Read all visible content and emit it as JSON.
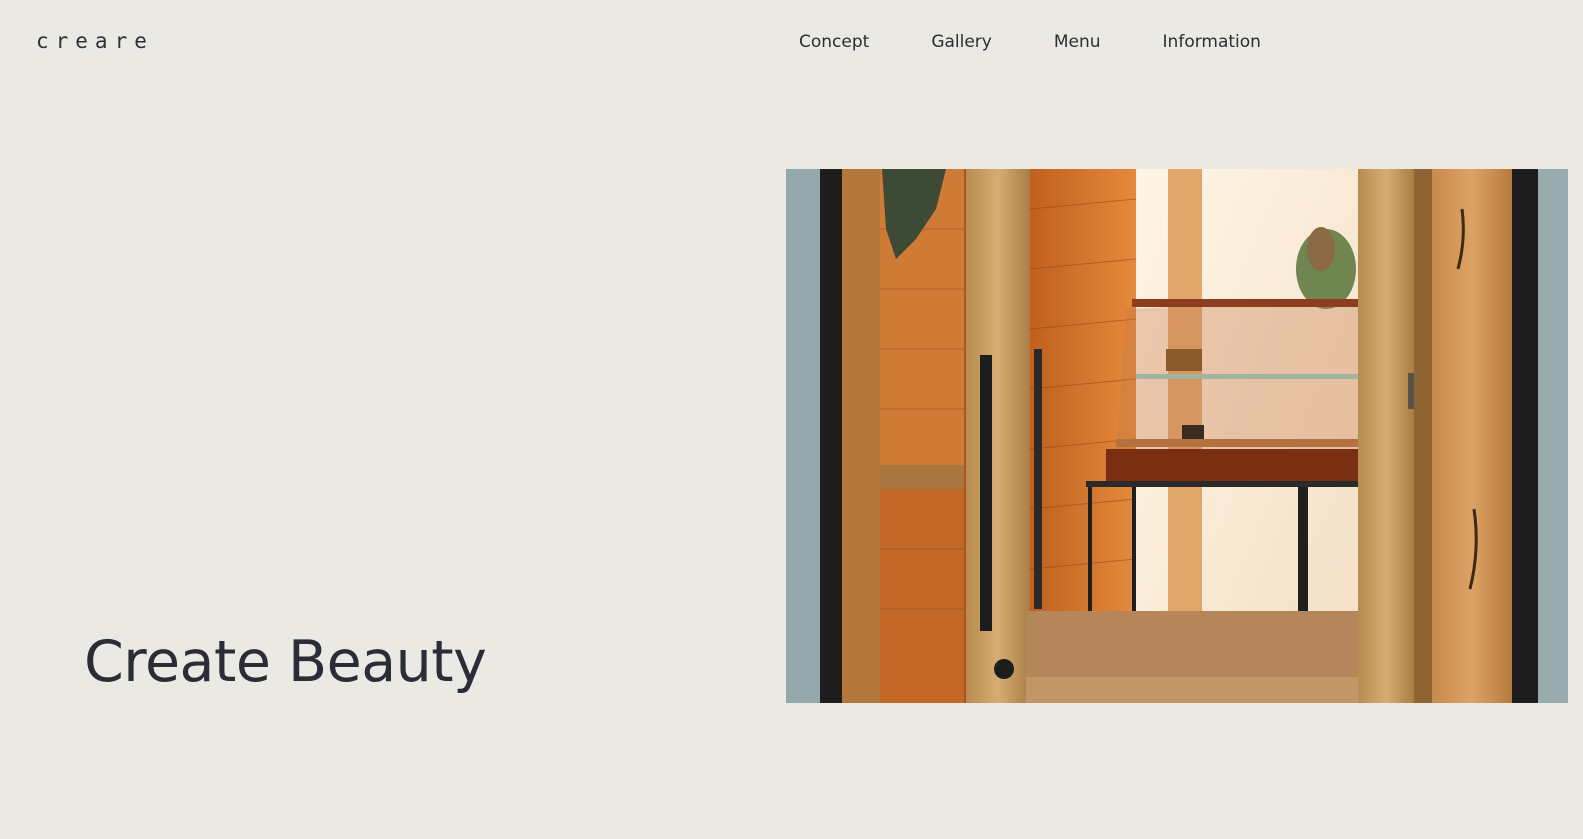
{
  "header": {
    "logo_text": "creare"
  },
  "nav": {
    "items": [
      {
        "label": "Concept"
      },
      {
        "label": "Gallery"
      },
      {
        "label": "Menu"
      },
      {
        "label": "Information"
      }
    ]
  },
  "hero": {
    "title": "Create Beauty"
  },
  "colors": {
    "background": "#eae9e4",
    "text": "#2b2d33",
    "wood": "#c77a3a",
    "wall": "#8fa3a6"
  }
}
